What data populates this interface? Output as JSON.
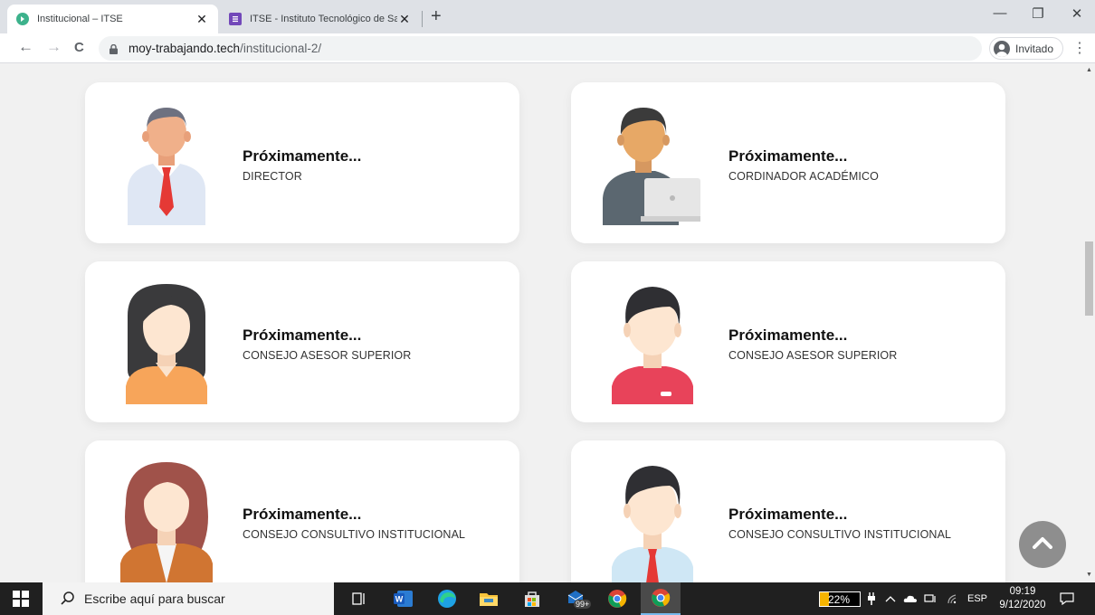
{
  "browser": {
    "tabs": [
      {
        "title": "Institucional – ITSE",
        "close": "✕"
      },
      {
        "title": "ITSE - Instituto Tecnológico de Sa",
        "close": "✕"
      }
    ],
    "new_tab": "+",
    "window_controls": {
      "minimize": "—",
      "restore": "❐",
      "close": "✕"
    },
    "url_host": "moy-trabajando.tech",
    "url_path": "/institucional-2/",
    "profile_label": "Invitado",
    "menu": "⋮",
    "nav": {
      "back": "←",
      "forward": "→",
      "reload": "C"
    }
  },
  "cards": [
    {
      "name": "Próximamente...",
      "role": "DIRECTOR",
      "avatar": "man-tie-icon"
    },
    {
      "name": "Próximamente...",
      "role": "CORDINADOR ACADÉMICO",
      "avatar": "man-laptop-icon"
    },
    {
      "name": "Próximamente...",
      "role": "CONSEJO ASESOR SUPERIOR",
      "avatar": "woman-dark-hair-icon"
    },
    {
      "name": "Próximamente...",
      "role": "CONSEJO ASESOR SUPERIOR",
      "avatar": "man-red-shirt-icon"
    },
    {
      "name": "Próximamente...",
      "role": "CONSEJO CONSULTIVO INSTITUCIONAL",
      "avatar": "woman-brown-hair-icon"
    },
    {
      "name": "Próximamente...",
      "role": "CONSEJO CONSULTIVO INSTITUCIONAL",
      "avatar": "man-blue-shirt-icon"
    }
  ],
  "taskbar": {
    "search_placeholder": "Escribe aquí para buscar",
    "mail_badge": "99+",
    "battery_percent": "22%",
    "battery_level": 0.22,
    "language": "ESP",
    "time": "09:19",
    "date": "9/12/2020"
  },
  "colors": {
    "accent_tab": "#1a73e8",
    "card_bg": "#ffffff",
    "page_bg": "#f1f1f1",
    "taskbar_bg": "#202020"
  }
}
